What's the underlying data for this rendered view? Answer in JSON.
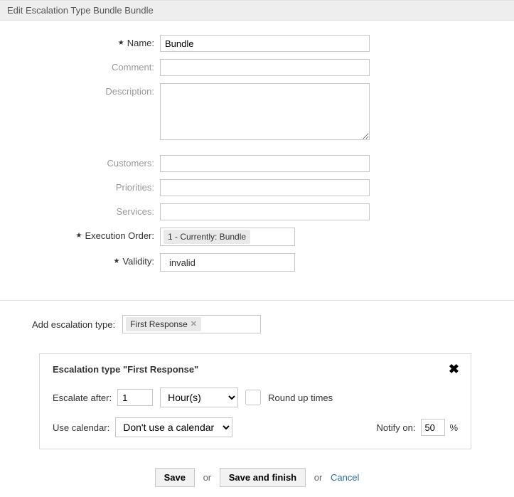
{
  "header": {
    "title": "Edit Escalation Type Bundle Bundle"
  },
  "form": {
    "name_label": "Name:",
    "name_value": "Bundle",
    "comment_label": "Comment:",
    "comment_value": "",
    "description_label": "Description:",
    "description_value": "",
    "customers_label": "Customers:",
    "priorities_label": "Priorities:",
    "services_label": "Services:",
    "exec_order_label": "Execution Order:",
    "exec_order_token": "1 - Currently: Bundle",
    "validity_label": "Validity:",
    "validity_value": "invalid"
  },
  "add_section": {
    "label": "Add escalation type:",
    "token": "First Response"
  },
  "card": {
    "title": "Escalation type \"First Response\"",
    "escalate_after_label": "Escalate after:",
    "escalate_after_value": "1",
    "unit_options": [
      "Hour(s)"
    ],
    "unit_value": "Hour(s)",
    "round_label": "Round up times",
    "use_calendar_label": "Use calendar:",
    "calendar_options": [
      "Don't use a calendar"
    ],
    "calendar_value": "Don't use a calendar",
    "notify_label": "Notify on:",
    "notify_value": "50",
    "notify_suffix": "%"
  },
  "footer": {
    "save": "Save",
    "or": "or",
    "save_finish": "Save and finish",
    "cancel": "Cancel"
  }
}
